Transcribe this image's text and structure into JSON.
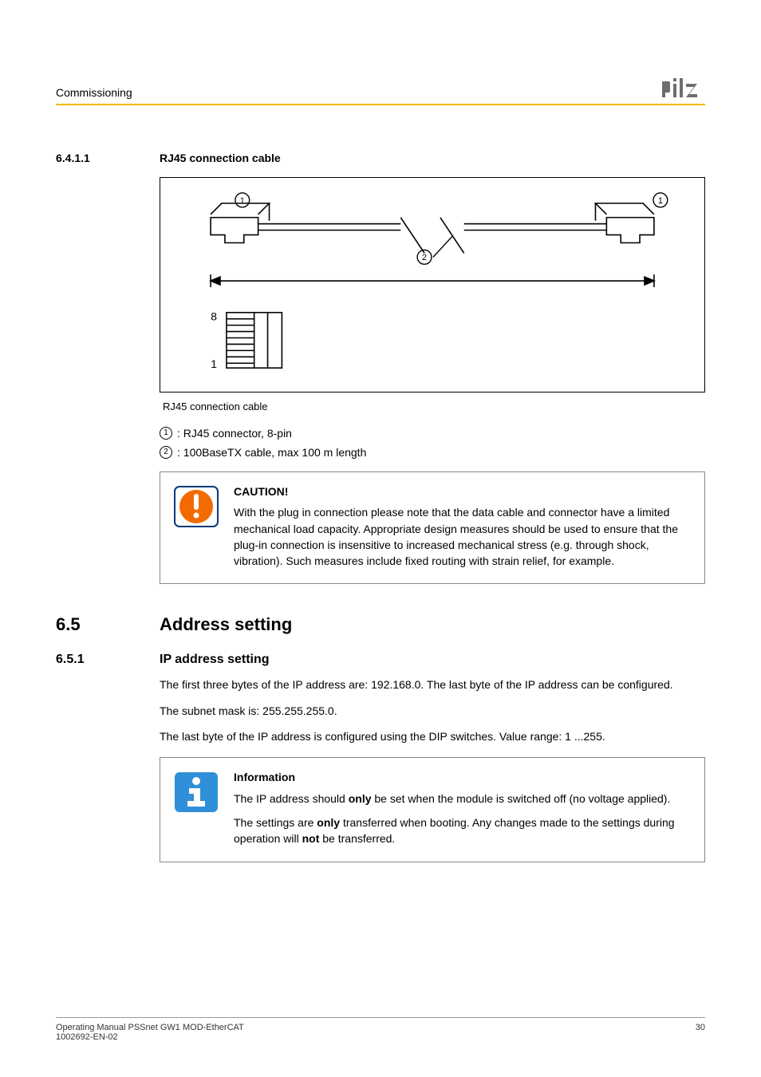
{
  "header": {
    "section": "Commissioning"
  },
  "sec_6_4_1_1": {
    "num": "6.4.1.1",
    "title": "RJ45 connection cable",
    "caption": "RJ45 connection cable",
    "legend1": ": RJ45 connector, 8-pin",
    "legend2": ": 100BaseTX cable, max 100 m length",
    "fig": {
      "pin8": "8",
      "pin1": "1",
      "m1": "1",
      "m2": "2"
    }
  },
  "caution": {
    "title": "CAUTION!",
    "body": "With the plug in connection please note that the data cable and connector have a limited mechanical load capacity. Appropriate design measures should be used to ensure that the plug-in connection is insensitive to increased mechanical stress (e.g. through shock, vibration). Such measures include fixed routing with strain relief, for example."
  },
  "sec_6_5": {
    "num": "6.5",
    "title": "Address setting"
  },
  "sec_6_5_1": {
    "num": "6.5.1",
    "title": "IP address setting",
    "p1": "The first three bytes of the IP address are: 192.168.0. The last byte of the IP address can be configured.",
    "p2": "The subnet mask is: 255.255.255.0.",
    "p3": "The last byte of the IP address is configured using the DIP switches. Value range: 1 ...255."
  },
  "info": {
    "title": "Information",
    "p1a": "The IP address should ",
    "p1b": "only",
    "p1c": " be set when the module is switched off (no voltage applied).",
    "p2a": "The settings are ",
    "p2b": "only",
    "p2c": " transferred when booting. Any changes made to the settings during operation will ",
    "p2d": "not",
    "p2e": " be transferred."
  },
  "footer": {
    "l1": "Operating Manual PSSnet GW1 MOD-EtherCAT",
    "l2": "1002692-EN-02",
    "page": "30"
  },
  "glyph": {
    "one": "1",
    "two": "2"
  }
}
